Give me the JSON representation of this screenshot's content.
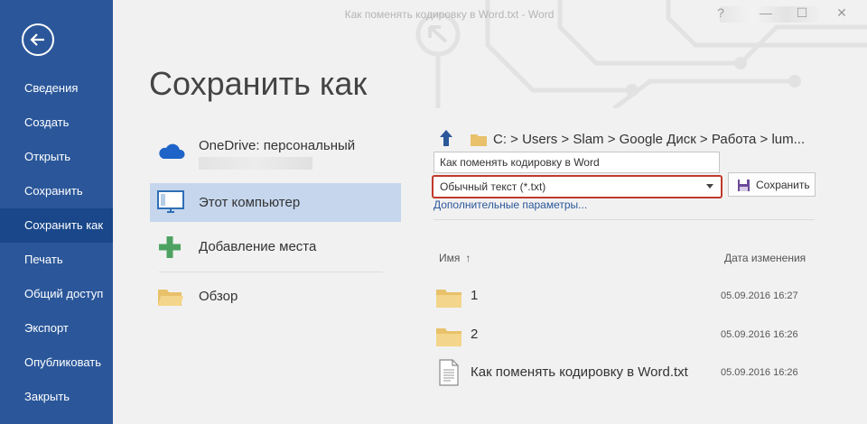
{
  "window": {
    "title": "Как поменять кодировку в Word.txt - Word",
    "help": "?",
    "minimize": "—",
    "restore": "☐",
    "close": "✕"
  },
  "sidebar": {
    "items": [
      {
        "label": "Сведения"
      },
      {
        "label": "Создать"
      },
      {
        "label": "Открыть"
      },
      {
        "label": "Сохранить"
      },
      {
        "label": "Сохранить как",
        "active": true
      },
      {
        "label": "Печать"
      },
      {
        "label": "Общий доступ"
      },
      {
        "label": "Экспорт"
      },
      {
        "label": "Опубликовать"
      },
      {
        "label": "Закрыть"
      }
    ]
  },
  "page": {
    "title": "Сохранить как"
  },
  "locations": {
    "onedrive": "OneDrive: персональный",
    "computer": "Этот компьютер",
    "add_place": "Добавление места",
    "browse": "Обзор"
  },
  "save_panel": {
    "path": "C: > Users > Slam > Google Диск > Работа > lum...",
    "filename": "Как поменять кодировку в Word",
    "file_type": "Обычный текст (*.txt)",
    "save_label": "Сохранить",
    "more_options": "Дополнительные параметры..."
  },
  "file_list": {
    "columns": {
      "name": "Имя",
      "sort_indicator": "↑",
      "date": "Дата изменения"
    },
    "rows": [
      {
        "name": "1",
        "date": "05.09.2016 16:27",
        "type": "folder"
      },
      {
        "name": "2",
        "date": "05.09.2016 16:26",
        "type": "folder"
      },
      {
        "name": "Как поменять кодировку в Word.txt",
        "date": "05.09.2016 16:26",
        "type": "text-file"
      }
    ]
  },
  "colors": {
    "accent": "#2b579a",
    "active_nav": "#19478a",
    "selected_location": "#c5d6ed",
    "highlight_box": "#c0392b",
    "folder": "#e8c16a"
  }
}
